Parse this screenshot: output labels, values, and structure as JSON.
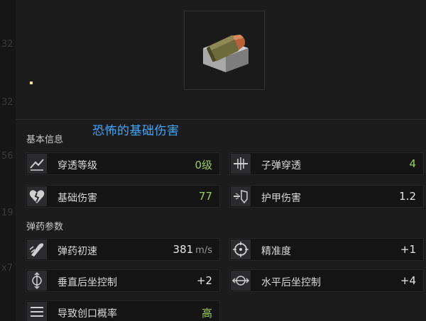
{
  "backdrop_numbers": [
    "32",
    "32",
    "56",
    "19",
    "x7"
  ],
  "annotation": "恐怖的基础伤害",
  "sections": {
    "basic": "基本信息",
    "ammo": "弹药参数"
  },
  "basic_stats": [
    {
      "label": "穿透等级",
      "value": "0级",
      "icon": "penetration-level-icon"
    },
    {
      "label": "子弹穿透",
      "value": "4",
      "icon": "bullet-penetration-icon"
    },
    {
      "label": "基础伤害",
      "value": "77",
      "icon": "broken-heart-icon"
    },
    {
      "label": "护甲伤害",
      "value": "1.2",
      "icon": "armor-damage-icon"
    }
  ],
  "ammo_stats": [
    {
      "label": "弹药初速",
      "value": "381",
      "unit": "m/s",
      "icon": "muzzle-velocity-icon"
    },
    {
      "label": "精准度",
      "value": "+1",
      "icon": "crosshair-icon"
    },
    {
      "label": "垂直后坐控制",
      "value": "+2",
      "icon": "vertical-recoil-icon"
    },
    {
      "label": "水平后坐控制",
      "value": "+4",
      "icon": "horizontal-recoil-icon"
    },
    {
      "label": "导致创口概率",
      "value": "高",
      "icon": "bleed-chance-icon"
    }
  ],
  "colors": {
    "value_green": "#9acd5a",
    "value_white": "#e6e6e6",
    "annotation_blue": "#3fa7ff"
  }
}
